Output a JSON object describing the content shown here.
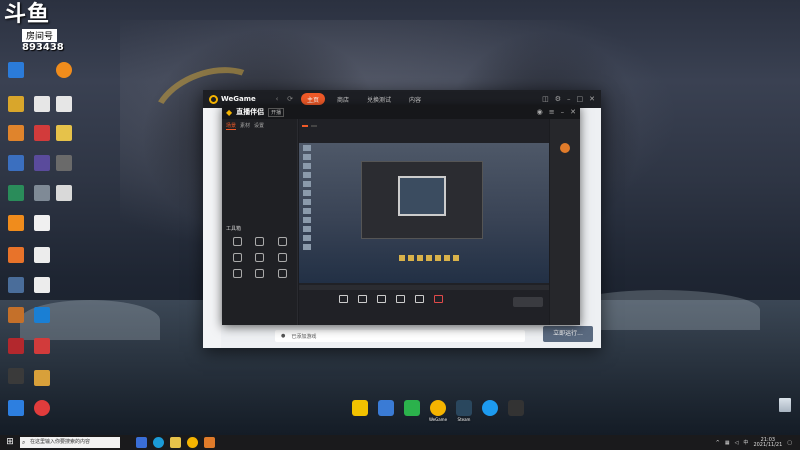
{
  "watermark": {
    "logo": "斗鱼",
    "room_label": "房间号",
    "room_number": "893438"
  },
  "wegame": {
    "brand": "WeGame",
    "tabs": [
      "主页",
      "商店",
      "兑换测试",
      "内容"
    ],
    "bottom_left": "",
    "bottom_bar": "已添加游戏",
    "launch_button": "立即运行..."
  },
  "live_app": {
    "title": "直播伴侣",
    "status_chip": "开播",
    "left_tabs": [
      "场景",
      "素材",
      "设置"
    ],
    "tools_header": "工具箱",
    "tools": [
      "",
      "",
      "",
      "",
      "",
      "",
      "",
      "",
      ""
    ],
    "footer": "",
    "breadcrumb": "",
    "tag": "",
    "subtabs": [
      "",
      ""
    ],
    "actions": [
      "",
      "",
      "",
      "",
      "",
      ""
    ],
    "start_button": ""
  },
  "taskbar": {
    "start_glyph": "⊞",
    "search_placeholder": "在这里输入你要搜索的内容",
    "tray_lang": "中",
    "time": "21:03",
    "date": "2021/11/21"
  },
  "dock": {
    "items": [
      {
        "label": "",
        "color": "#f2c200"
      },
      {
        "label": "",
        "color": "#3a7bd5"
      },
      {
        "label": "",
        "color": "#2bb24c"
      },
      {
        "label": "WeGame",
        "color": "#f5b400"
      },
      {
        "label": "Steam",
        "color": "#2a475e"
      },
      {
        "label": "",
        "color": "#1d9bf0"
      },
      {
        "label": "",
        "color": "#333333"
      }
    ]
  },
  "recycle_bin": {
    "label": ""
  }
}
